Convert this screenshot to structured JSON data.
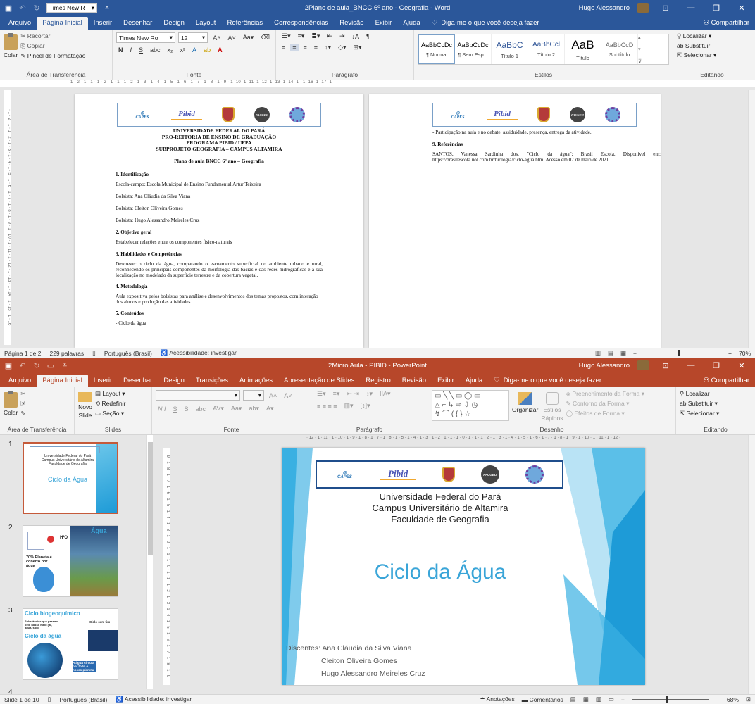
{
  "word": {
    "font_name": "Times New R",
    "title": "2Plano de aula_BNCC 6º ano - Geografia  -  Word",
    "user": "Hugo Alessandro",
    "tabs": [
      "Arquivo",
      "Página Inicial",
      "Inserir",
      "Desenhar",
      "Design",
      "Layout",
      "Referências",
      "Correspondências",
      "Revisão",
      "Exibir",
      "Ajuda"
    ],
    "tell_me": "Diga-me o que você deseja fazer",
    "share": "Compartilhar",
    "clipboard": {
      "paste": "Colar",
      "cut": "Recortar",
      "copy": "Copiar",
      "format_painter": "Pincel de Formatação",
      "label": "Área de Transferência"
    },
    "font": {
      "name": "Times New Ro",
      "size": "12",
      "label": "Fonte"
    },
    "paragraph_label": "Parágrafo",
    "styles": [
      {
        "preview": "AaBbCcDc",
        "name": "¶ Normal"
      },
      {
        "preview": "AaBbCcDc",
        "name": "¶ Sem Esp..."
      },
      {
        "preview": "AaBbC",
        "name": "Título 1"
      },
      {
        "preview": "AaBbCcl",
        "name": "Título 2"
      },
      {
        "preview": "AaB",
        "name": "Título"
      },
      {
        "preview": "AaBbCcD",
        "name": "Subtítulo"
      }
    ],
    "styles_label": "Estilos",
    "editing": {
      "find": "Localizar",
      "replace": "Substituir",
      "select": "Selecionar",
      "label": "Editando"
    },
    "ruler": "1 · 2 · 1 · 1 · 1 · 2 · 1 · 1 · 1 · 2 · 1 · 3 · 1 · 4 · 1 · 5 · 1 · 6 · 1 · 7 · 1 · 8 · 1 · 9 · 1 ·10· 1 ·11· 1 ·12· 1 ·13· 1 ·14· 1 · 1 ·16· 1 ·17· 1",
    "vruler": "· 1 · 2 · 1 · 1 · 2 · 1 · 3 · 1 · 4 · 1 · 5 · 1 · 6 · 1 · 7 · 1 · 8 · 1 · 9 · 1 · 10 · 1 · 11 · 1 · 12 · 1 · 13 · 1 · 14 · 1 · 15 · 1 · 16",
    "page1": {
      "header": [
        "UNIVERSIDADE FEDERAL DO PARÁ",
        "PRO-REITORIA DE ENSINO DE GRADUAÇÃO",
        "PROGRAMA PIBID / UFPA",
        "SUBPROJETO GEOGRAFIA – CAMPUS ALTAMIRA"
      ],
      "plan_title": "Plano de aula BNCC 6º ano – Geografia",
      "s1": "1. Identificação",
      "school": "Escola-campo: Escola Municipal de Ensino Fundamental Artur Teixeira",
      "b1": "Bolsista: Ana Cláudia da Silva Viana",
      "b2": "Bolsista: Cleiton Oliveira Gomes",
      "b3": "Bolsista: Hugo Alessandro Meireles Cruz",
      "s2": "2. Objetivo geral",
      "obj": "Estabelecer relações entre os componentes físico-naturais",
      "s3": "3. Habilidades e Competências",
      "hab": "Descrever o ciclo da água, comparando o escoamento superficial no ambiente urbano e rural, reconhecendo os principais componentes da morfologia das bacias e das redes hidrográficas e a sua localização no modelado da superfície terrestre e da cobertura vegetal.",
      "s4": "4. Metodologia",
      "met": "Aula expositiva pelos bolsistas para análise e desenvolvimentos dos temas propostos, com interação dos alunos e produção das atividades.",
      "s5": "5. Conteúdos",
      "c1": "- Ciclo da água"
    },
    "page2": {
      "line": "- Participação na aula e no debate, assiduidade, presença, entrega da atividade.",
      "s9": "9. Referências",
      "ref": "SANTOS, Vanessa Sardinha dos. \"Ciclo da água\"; Brasil Escola. Disponível em: https://brasilescola.uol.com.br/biologia/ciclo-agua.htm. Acesso em 07 de maio de 2021."
    },
    "logos": {
      "capes": "CAPES",
      "pibid": "Pibid",
      "facgeo": "FACGEO"
    },
    "status": {
      "page": "Página 1 de 2",
      "words": "229 palavras",
      "lang": "Português (Brasil)",
      "access": "Acessibilidade: investigar",
      "zoom": "70%"
    }
  },
  "ppt": {
    "title": "2Micro Aula - PIBID  -  PowerPoint",
    "user": "Hugo Alessandro",
    "tabs": [
      "Arquivo",
      "Página Inicial",
      "Inserir",
      "Desenhar",
      "Design",
      "Transições",
      "Animações",
      "Apresentação de Slides",
      "Registro",
      "Revisão",
      "Exibir",
      "Ajuda"
    ],
    "tell_me": "Diga-me o que você deseja fazer",
    "share": "Compartilhar",
    "clipboard": {
      "paste": "Colar",
      "label": "Área de Transferência"
    },
    "slides": {
      "new": "Novo",
      "new2": "Slide",
      "layout": "Layout",
      "reset": "Redefinir",
      "section": "Seção",
      "label": "Slides"
    },
    "font_label": "Fonte",
    "paragraph_label": "Parágrafo",
    "drawing": {
      "arrange": "Organizar",
      "quick": "Estilos",
      "quick2": "Rápidos",
      "fill": "Preenchimento da Forma",
      "outline": "Contorno da Forma",
      "effects": "Efeitos de Forma",
      "label": "Desenho"
    },
    "editing": {
      "find": "Localizar",
      "replace": "Substituir",
      "select": "Selecionar",
      "label": "Editando"
    },
    "hruler": "· 12 · 1 · 11 · 1 · 10 · 1 · 9 · 1 · 8 · 1 · 7 · 1 · 6 · 1 · 5 · 1 · 4 · 1 · 3 · 1 · 2 · 1 · 1 · 1 · 0 · 1 · 1 · 1 · 2 · 1 · 3 · 1 · 4 · 1 · 5 · 1 · 6 · 1 · 7 · 1 · 8 · 1 · 9 · 1 · 10 · 1 · 11 · 1 · 12 ·",
    "vruler": "· 9 · 1 · 8 · 1 · 7 · 1 · 6 · 1 · 5 · 1 · 4 · 1 · 3 · 1 · 2 · 1 · 1 · 1 · 0 · 1 · 1 · 1 · 2 · 1 · 3 · 1 · 4 · 1 · 5 · 1 · 6 · 1 · 7 · 1 · 8 · 1 · 9 ·",
    "thumbs": [
      {
        "num": "1",
        "title": "Ciclo da Água",
        "lines": [
          "Universidade Federal do Pará",
          "Campus Universitário de Altamira",
          "Faculdade de Geografia"
        ]
      },
      {
        "num": "2",
        "title": "Água",
        "label1": "H²O",
        "label2": "70% Planeta é coberto por água"
      },
      {
        "num": "3",
        "title": "Ciclo biogeoquímico",
        "sub": "Ciclo da água",
        "l1": "Substâncias que passam pelo nosso meio (ar, água, solo)",
        "l2": "Ciclo sem fim",
        "l3": "A água circula por todo o nosso planeta"
      },
      {
        "num": "4"
      }
    ],
    "slide": {
      "lines": [
        "Universidade Federal do Pará",
        "Campus Universitário de Altamira",
        "Faculdade de Geografia"
      ],
      "title": "Ciclo da Água",
      "students_label": "Discentes:",
      "students": [
        "Ana Cláudia da Silva Viana",
        "Cleiton Oliveira Gomes",
        "Hugo Alessandro Meireles Cruz"
      ]
    },
    "logos": {
      "capes": "CAPES",
      "pibid": "Pibid",
      "facgeo": "FACGEO"
    },
    "status": {
      "slide": "Slide 1 de 10",
      "lang": "Português (Brasil)",
      "access": "Acessibilidade: investigar",
      "notes": "Anotações",
      "comments": "Comentários",
      "zoom": "68%"
    },
    "colors": {
      "accent": "#b7472a",
      "title_blue": "#3aa5d8",
      "slide_blue": "#1e9bd7"
    }
  }
}
